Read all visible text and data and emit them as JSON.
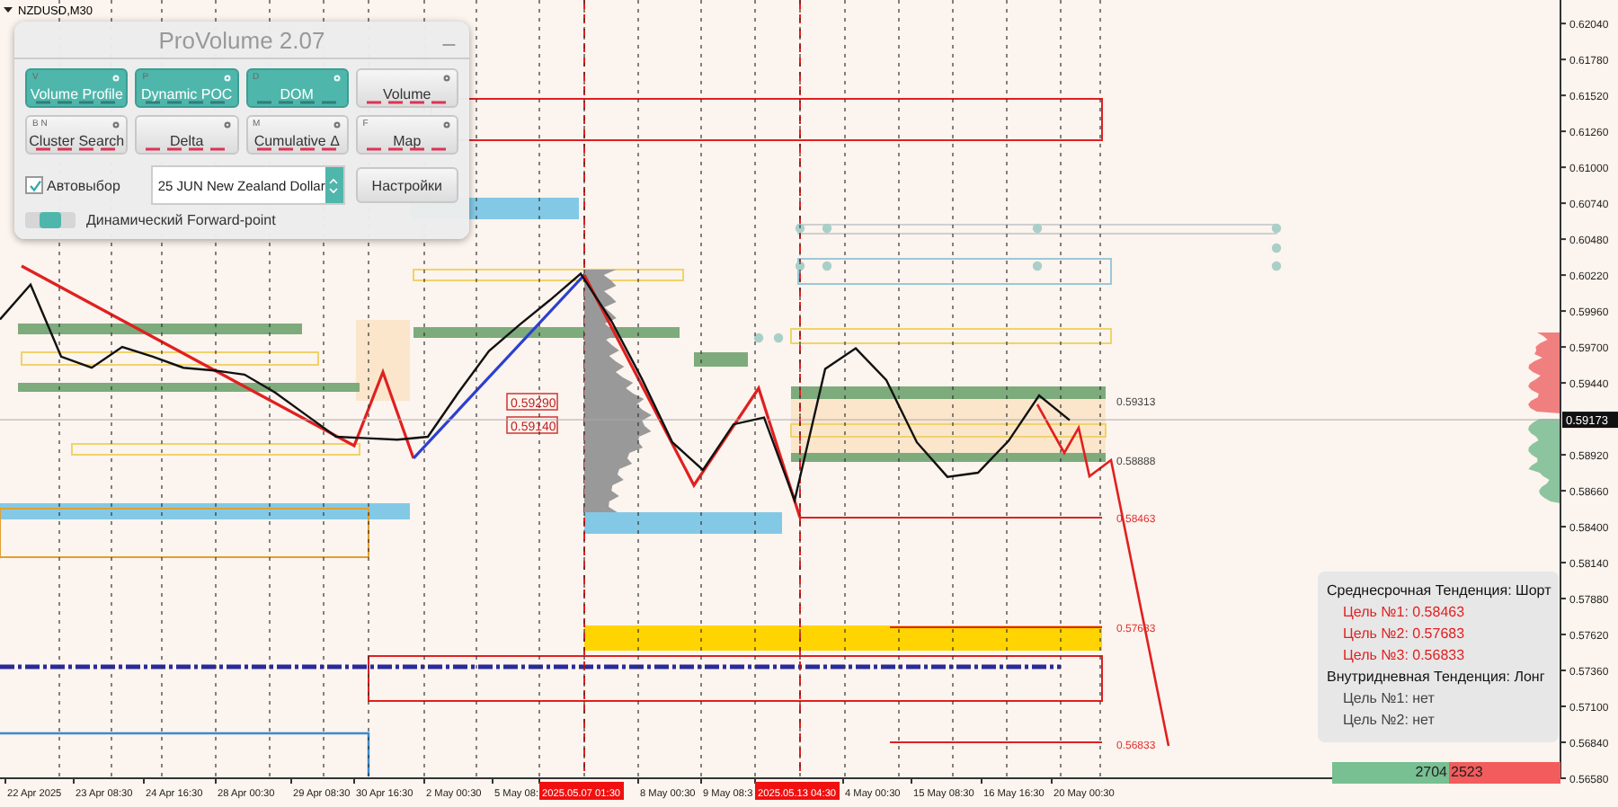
{
  "chart": {
    "symbol": "NZDUSD,M30",
    "price_axis": {
      "current_price": "0.59173"
    },
    "time_axis": {
      "labels": [
        {
          "text": "22 Apr 2025",
          "highlighted": false
        },
        {
          "text": "23 Apr 08:30",
          "highlighted": false
        },
        {
          "text": "24 Apr 16:30",
          "highlighted": false
        },
        {
          "text": "28 Apr 00:30",
          "highlighted": false
        },
        {
          "text": "29 Apr 08:30",
          "highlighted": false
        },
        {
          "text": "30 Apr 16:30",
          "highlighted": false
        },
        {
          "text": "2 May 00:30",
          "highlighted": false
        },
        {
          "text": "5 May 08:",
          "highlighted": false
        },
        {
          "text": "2025.05.07 01:30",
          "highlighted": true
        },
        {
          "text": "8 May 00:30",
          "highlighted": false
        },
        {
          "text": "9 May 08:3",
          "highlighted": false
        },
        {
          "text": "2025.05.13 04:30",
          "highlighted": true
        },
        {
          "text": "4 May 00:30",
          "highlighted": false
        },
        {
          "text": "15 May 08:30",
          "highlighted": false
        },
        {
          "text": "16 May 16:30",
          "highlighted": false
        },
        {
          "text": "20 May 00:30",
          "highlighted": false
        }
      ]
    },
    "level_labels": [
      {
        "text": "0.59290",
        "kind": "boxed"
      },
      {
        "text": "0.59140",
        "kind": "boxed"
      },
      {
        "text": "0.59313",
        "kind": "plain"
      },
      {
        "text": "0.58888",
        "kind": "plain"
      },
      {
        "text": "0.58463",
        "kind": "target"
      },
      {
        "text": "0.57683",
        "kind": "target"
      },
      {
        "text": "0.56833",
        "kind": "target"
      }
    ],
    "volume_balance": {
      "buy": "2704",
      "sell": "2523"
    },
    "chart_data": {
      "type": "line",
      "ylim": [
        0.5658,
        0.6221
      ],
      "grid": true,
      "yticks": [
        {
          "value": 0.6204,
          "label": "0.62040"
        },
        {
          "value": 0.6178,
          "label": "0.61780"
        },
        {
          "value": 0.6152,
          "label": "0.61520"
        },
        {
          "value": 0.6126,
          "label": "0.61260"
        },
        {
          "value": 0.61,
          "label": "0.61000"
        },
        {
          "value": 0.6074,
          "label": "0.60740"
        },
        {
          "value": 0.6048,
          "label": "0.60480"
        },
        {
          "value": 0.6022,
          "label": "0.60220"
        },
        {
          "value": 0.5996,
          "label": "0.59960"
        },
        {
          "value": 0.597,
          "label": "0.59700"
        },
        {
          "value": 0.5944,
          "label": "0.59440"
        },
        {
          "value": 0.5892,
          "label": "0.58920"
        },
        {
          "value": 0.5866,
          "label": "0.58660"
        },
        {
          "value": 0.584,
          "label": "0.58400"
        },
        {
          "value": 0.5814,
          "label": "0.58140"
        },
        {
          "value": 0.5788,
          "label": "0.57880"
        },
        {
          "value": 0.5762,
          "label": "0.57620"
        },
        {
          "value": 0.5736,
          "label": "0.57360"
        },
        {
          "value": 0.571,
          "label": "0.57100"
        },
        {
          "value": 0.5684,
          "label": "0.56840"
        },
        {
          "value": 0.5658,
          "label": "0.56580"
        }
      ],
      "series": [
        {
          "color": "#111111",
          "values": [
            0.599,
            0.6015,
            0.5963,
            0.5955,
            0.597,
            0.5963,
            0.5955,
            0.5953,
            0.595,
            0.5937,
            0.5921,
            0.5905,
            0.5904,
            0.5903,
            0.5905,
            0.5937,
            0.5967,
            0.5986,
            0.6004,
            0.6023,
            0.5989,
            0.5947,
            0.5901,
            0.5881,
            0.5914,
            0.5919,
            0.5859,
            0.5954,
            0.5969,
            0.5946,
            0.5901,
            0.5876,
            0.5879,
            0.5902,
            0.5935,
            0.5917
          ]
        }
      ]
    }
  },
  "panel": {
    "title": "ProVolume 2.07",
    "minimize": "_",
    "buttons": [
      {
        "label": "Volume Profile",
        "hotkey": "V",
        "on": true
      },
      {
        "label": "Dynamic POC",
        "hotkey": "P",
        "on": true
      },
      {
        "label": "DOM",
        "hotkey": "D",
        "on": true
      },
      {
        "label": "Volume",
        "on": false
      },
      {
        "label": "Cluster Search",
        "hotkey": "B N",
        "on": false
      },
      {
        "label": "Delta",
        "on": false
      },
      {
        "label": "Cumulative Δ",
        "hotkey": "M",
        "on": false
      },
      {
        "label": "Map",
        "hotkey": "F",
        "on": false
      }
    ],
    "auto_select": {
      "label": "Автовыбор",
      "checked": true
    },
    "instrument": {
      "value": "25 JUN New Zealand Dollar"
    },
    "settings_button": "Настройки",
    "forward_point": {
      "label": "Динамический Forward-point",
      "on": true
    }
  },
  "trend_box": {
    "lines": [
      {
        "text": "Среднесрочная Тенденция: Шорт",
        "kind": "heading"
      },
      {
        "text": "Цель №1: 0.58463",
        "kind": "target"
      },
      {
        "text": "Цель №2: 0.57683",
        "kind": "target"
      },
      {
        "text": "Цель №3: 0.56833",
        "kind": "target"
      },
      {
        "text": "Внутридневная Тенденция: Лонг",
        "kind": "heading"
      },
      {
        "text": "Цель №1: нет",
        "kind": "none"
      },
      {
        "text": "Цель №2: нет",
        "kind": "none"
      }
    ]
  }
}
